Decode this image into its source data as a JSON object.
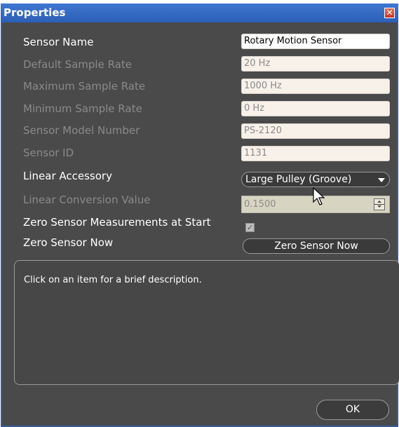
{
  "window": {
    "title": "Properties",
    "close_glyph": "✕"
  },
  "rows": [
    {
      "label": "Sensor Name",
      "value": "Rotary Motion Sensor"
    },
    {
      "label": "Default Sample Rate",
      "value": "20 Hz"
    },
    {
      "label": "Maximum Sample Rate",
      "value": "1000 Hz"
    },
    {
      "label": "Minimum Sample Rate",
      "value": "0 Hz"
    },
    {
      "label": "Sensor Model Number",
      "value": "PS-2120"
    },
    {
      "label": "Sensor ID",
      "value": "1131"
    },
    {
      "label": "Linear Accessory",
      "value": "Large Pulley (Groove)"
    },
    {
      "label": "Linear Conversion Value",
      "value": "0.1500"
    },
    {
      "label": "Zero Sensor Measurements at Start",
      "checked": true,
      "check_glyph": "✓"
    },
    {
      "label": "Zero Sensor Now",
      "button": "Zero Sensor Now"
    }
  ],
  "description": "Click on an item for a brief description.",
  "ok_label": "OK",
  "colors": {
    "titlebar": "#2c5fb8",
    "background": "#4a4a4a",
    "close": "#c9351f"
  }
}
